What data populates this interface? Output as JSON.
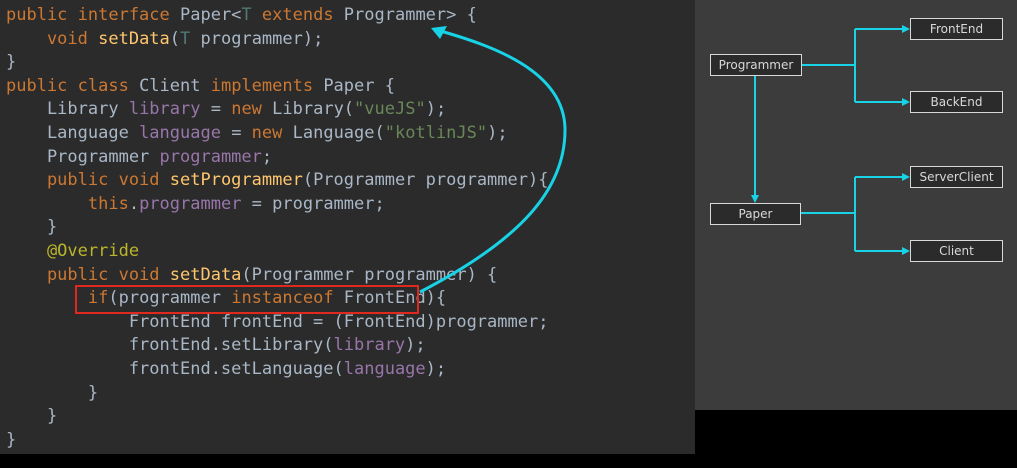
{
  "code": {
    "lines": [
      [
        {
          "t": "public interface ",
          "c": "kw"
        },
        {
          "t": "Paper<",
          "c": ""
        },
        {
          "t": "T",
          "c": "tp"
        },
        {
          "t": " extends ",
          "c": "kw"
        },
        {
          "t": "Programmer> {",
          "c": ""
        }
      ],
      [
        {
          "t": "    void ",
          "c": "kw"
        },
        {
          "t": "setData",
          "c": "fn"
        },
        {
          "t": "(",
          "c": ""
        },
        {
          "t": "T",
          "c": "tp"
        },
        {
          "t": " programmer);",
          "c": ""
        }
      ],
      [
        {
          "t": "}",
          "c": ""
        }
      ],
      [
        {
          "t": "public class ",
          "c": "kw"
        },
        {
          "t": "Client ",
          "c": ""
        },
        {
          "t": "implements ",
          "c": "kw"
        },
        {
          "t": "Paper {",
          "c": ""
        }
      ],
      [
        {
          "t": "    Library ",
          "c": ""
        },
        {
          "t": "library",
          "c": "fld"
        },
        {
          "t": " = ",
          "c": ""
        },
        {
          "t": "new ",
          "c": "kw"
        },
        {
          "t": "Library(",
          "c": ""
        },
        {
          "t": "\"vueJS\"",
          "c": "str"
        },
        {
          "t": ");",
          "c": ""
        }
      ],
      [
        {
          "t": "    Language ",
          "c": ""
        },
        {
          "t": "language",
          "c": "fld"
        },
        {
          "t": " = ",
          "c": ""
        },
        {
          "t": "new ",
          "c": "kw"
        },
        {
          "t": "Language(",
          "c": ""
        },
        {
          "t": "\"kotlinJS\"",
          "c": "str"
        },
        {
          "t": ");",
          "c": ""
        }
      ],
      [
        {
          "t": "    Programmer ",
          "c": ""
        },
        {
          "t": "programmer",
          "c": "fld"
        },
        {
          "t": ";",
          "c": ""
        }
      ],
      [
        {
          "t": "    public void ",
          "c": "kw"
        },
        {
          "t": "setProgrammer",
          "c": "fn"
        },
        {
          "t": "(Programmer programmer){",
          "c": ""
        }
      ],
      [
        {
          "t": "        this",
          "c": "kw"
        },
        {
          "t": ".",
          "c": ""
        },
        {
          "t": "programmer",
          "c": "fld"
        },
        {
          "t": " = programmer;",
          "c": ""
        }
      ],
      [
        {
          "t": "    }",
          "c": ""
        }
      ],
      [
        {
          "t": "    @Override",
          "c": "ann"
        }
      ],
      [
        {
          "t": "    public void ",
          "c": "kw"
        },
        {
          "t": "setData",
          "c": "fn"
        },
        {
          "t": "(Programmer programmer) {",
          "c": ""
        }
      ],
      [
        {
          "t": "        ",
          "c": ""
        },
        {
          "t": "if",
          "c": "kw"
        },
        {
          "t": "(programmer ",
          "c": ""
        },
        {
          "t": "instanceof ",
          "c": "kw"
        },
        {
          "t": "FrontEnd){",
          "c": ""
        }
      ],
      [
        {
          "t": "            FrontEnd frontEnd = (FrontEnd)programmer;",
          "c": ""
        }
      ],
      [
        {
          "t": "            frontEnd.setLibrary(",
          "c": ""
        },
        {
          "t": "library",
          "c": "fld"
        },
        {
          "t": ");",
          "c": ""
        }
      ],
      [
        {
          "t": "            frontEnd.setLanguage(",
          "c": ""
        },
        {
          "t": "language",
          "c": "fld"
        },
        {
          "t": ");",
          "c": ""
        }
      ],
      [
        {
          "t": "        }",
          "c": ""
        }
      ],
      [
        {
          "t": "    }",
          "c": ""
        }
      ],
      [
        {
          "t": "}",
          "c": ""
        }
      ]
    ]
  },
  "diagram": {
    "nodes": {
      "programmer": "Programmer",
      "frontend": "FrontEnd",
      "backend": "BackEnd",
      "paper": "Paper",
      "serverclient": "ServerClient",
      "client": "Client"
    }
  },
  "colors": {
    "arrow": "#18d2e6",
    "highlight": "#e0291e"
  }
}
